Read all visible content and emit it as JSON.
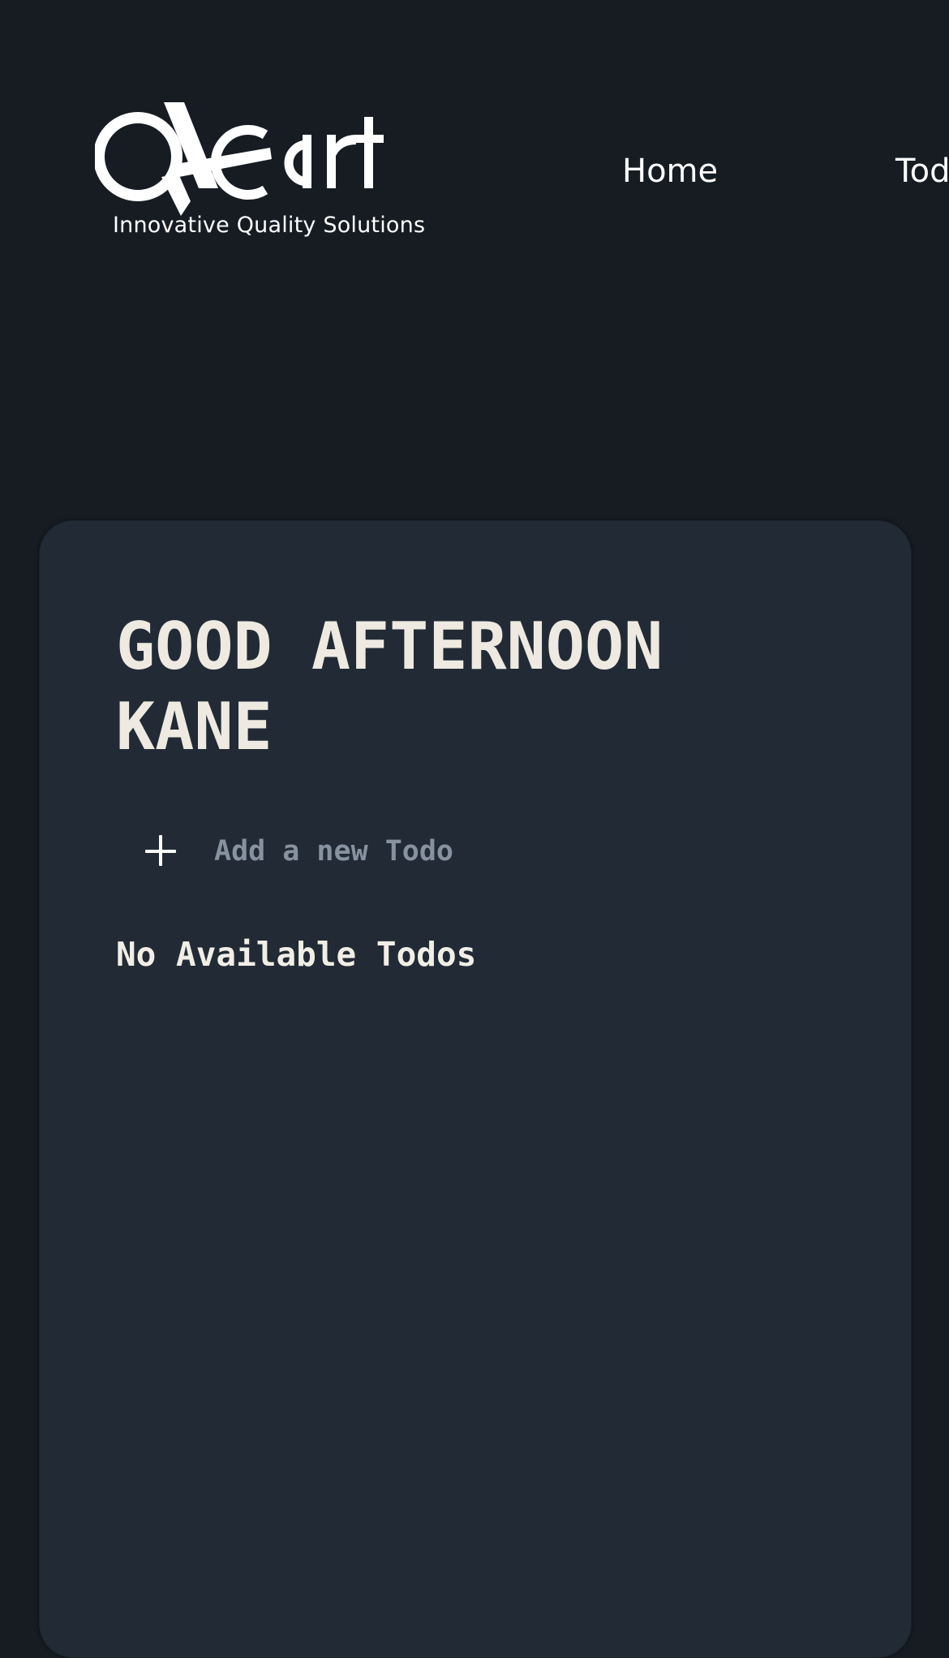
{
  "header": {
    "logo": {
      "wordmark": "QACart",
      "tagline": "Innovative Quality Solutions"
    },
    "nav": [
      {
        "label": "Home"
      },
      {
        "label": "Todo"
      }
    ]
  },
  "main": {
    "greeting": "GOOD AFTERNOON KANE",
    "add_todo": {
      "icon": "plus-icon",
      "placeholder": "Add a new Todo",
      "value": ""
    },
    "empty_message": "No Available Todos"
  },
  "colors": {
    "page_background": "#171c23",
    "card_background": "#222b35",
    "heading_text": "#eeeae2",
    "placeholder_text": "#8792a0"
  }
}
